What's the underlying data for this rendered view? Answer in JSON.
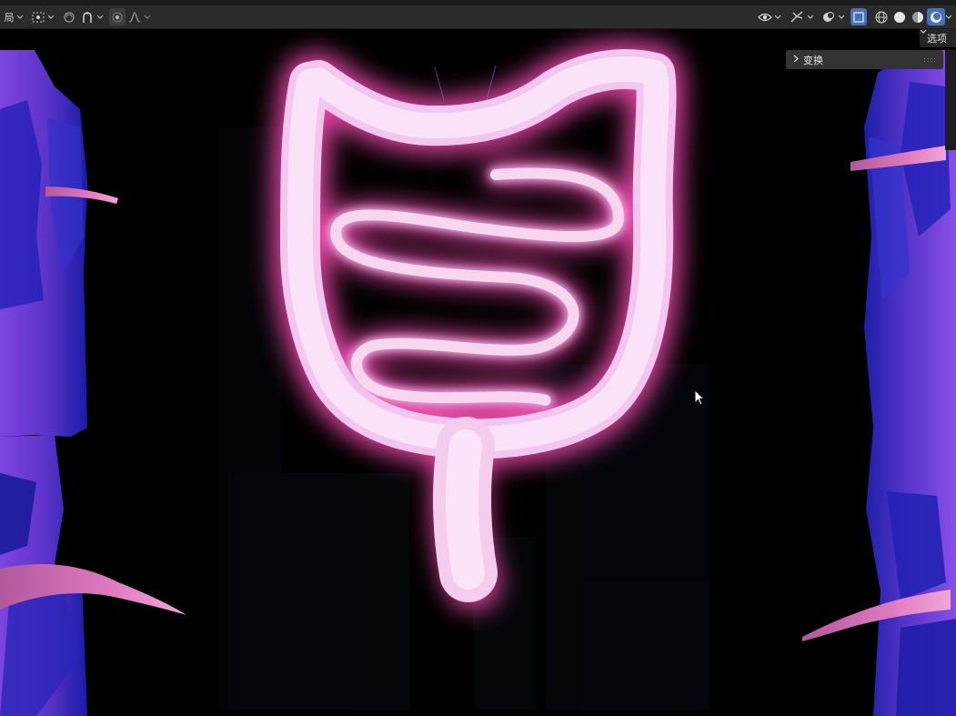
{
  "header": {
    "left_mode_text": "局",
    "tools": [
      {
        "name": "pivot-icon"
      },
      {
        "name": "snap-icon"
      },
      {
        "name": "magnet-icon"
      },
      {
        "name": "proportional-edit-icon"
      },
      {
        "name": "falloff-curve-icon"
      }
    ],
    "right_tools": [
      {
        "name": "visibility-eye-icon"
      },
      {
        "name": "gizmo-icon"
      },
      {
        "name": "overlay-icon"
      },
      {
        "name": "xray-toggle-icon"
      },
      {
        "name": "wireframe-shading-icon"
      },
      {
        "name": "solid-shading-icon"
      },
      {
        "name": "material-shading-icon"
      },
      {
        "name": "rendered-shading-icon"
      }
    ]
  },
  "options_label": "选项",
  "npanel": {
    "transform_label": "变换"
  },
  "colors": {
    "toolbar_bg": "#2b2b2b",
    "viewport_bg": "#000000",
    "glow_pink": "#ff6fc8",
    "intestine_light": "#f6d8f4",
    "rock_purple": "#6a3ed6",
    "rock_blue": "#1c1aa0",
    "active_blue": "#4772b3"
  }
}
